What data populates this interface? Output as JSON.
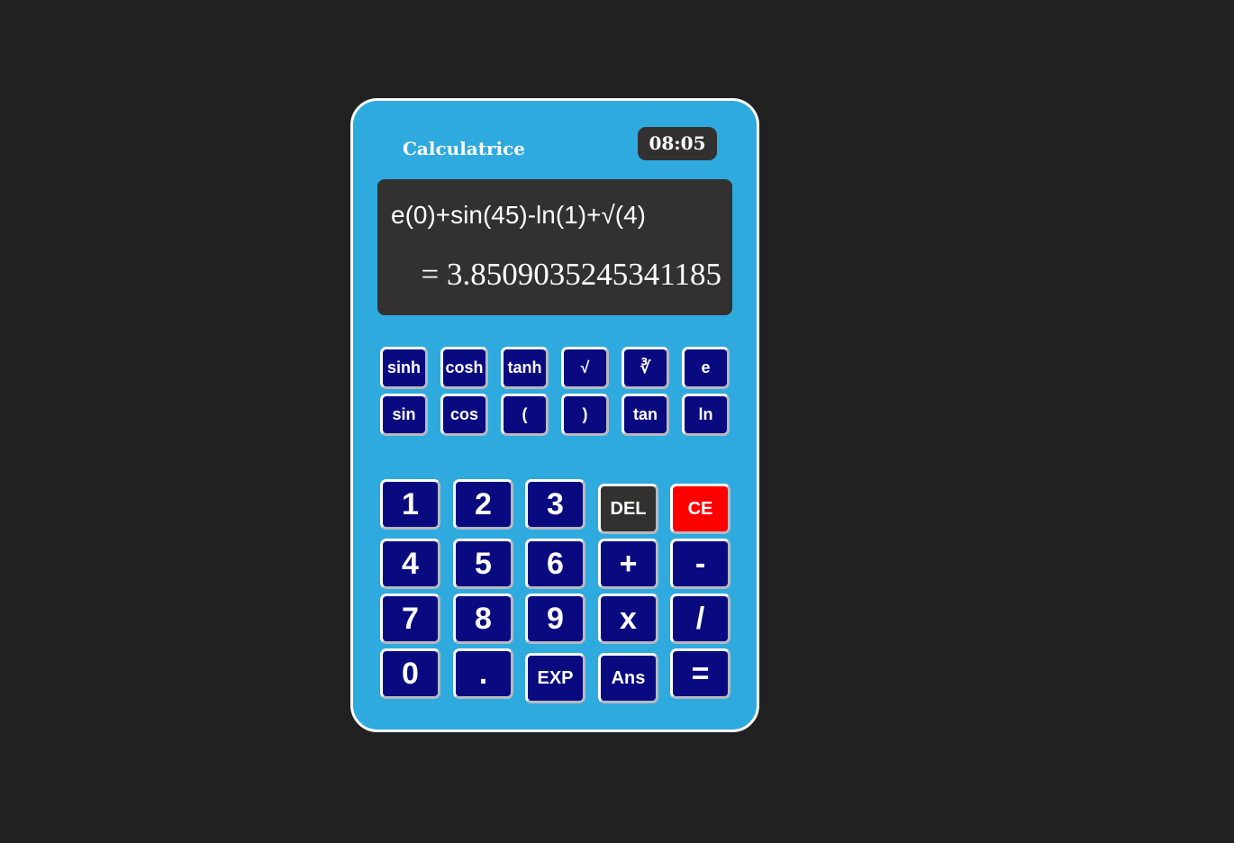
{
  "app": {
    "title": "Calculatrice",
    "clock": "08:05"
  },
  "display": {
    "expression": "e(0)+sin(45)-ln(1)+√(4)",
    "result": "= 3.8509035245341185"
  },
  "scientific_keys": {
    "sinh": "sinh",
    "cosh": "cosh",
    "tanh": "tanh",
    "sqrt": "√",
    "cbrt": "∛",
    "e": "e",
    "sin": "sin",
    "cos": "cos",
    "paren_open": "(",
    "paren_close": ")",
    "tan": "tan",
    "ln": "ln"
  },
  "keypad": {
    "k1": "1",
    "k2": "2",
    "k3": "3",
    "del": "DEL",
    "ce": "CE",
    "k4": "4",
    "k5": "5",
    "k6": "6",
    "plus": "+",
    "minus": "-",
    "k7": "7",
    "k8": "8",
    "k9": "9",
    "times": "x",
    "divide": "/",
    "k0": "0",
    "dot": ".",
    "exp": "EXP",
    "ans": "Ans",
    "equals": "="
  },
  "colors": {
    "body_background": "#212121",
    "calculator_background": "#2eaadf",
    "key_background": "#0a0a80",
    "display_background": "#333030",
    "del_key": "#333030",
    "ce_key": "#ff0000"
  }
}
